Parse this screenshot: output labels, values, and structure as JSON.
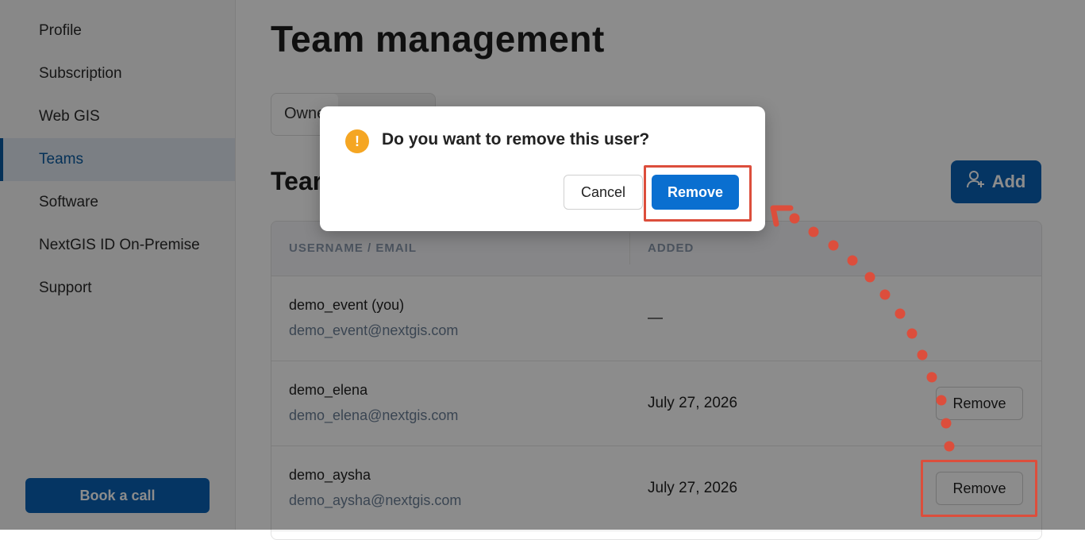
{
  "sidebar": {
    "items": [
      {
        "label": "Profile"
      },
      {
        "label": "Subscription"
      },
      {
        "label": "Web GIS"
      },
      {
        "label": "Teams"
      },
      {
        "label": "Software"
      },
      {
        "label": "NextGIS ID On-Premise"
      },
      {
        "label": "Support"
      }
    ],
    "active_item": "Teams",
    "book_call_label": "Book a call"
  },
  "main": {
    "title": "Team management",
    "tabs": [
      {
        "label": "Owne"
      }
    ],
    "section_title": "Tear",
    "add_label": "Add",
    "table": {
      "headers": [
        "USERNAME / EMAIL",
        "ADDED"
      ],
      "rows": [
        {
          "name": "demo_event (you)",
          "email": "demo_event@nextgis.com",
          "added": "—",
          "action": ""
        },
        {
          "name": "demo_elena",
          "email": "demo_elena@nextgis.com",
          "added": "July 27, 2026",
          "action": "Remove"
        },
        {
          "name": "demo_aysha",
          "email": "demo_aysha@nextgis.com",
          "added": "July 27, 2026",
          "action": "Remove"
        }
      ]
    }
  },
  "dialog": {
    "message": "Do you want to remove this user?",
    "icon": "warning-icon",
    "icon_glyph": "!",
    "cancel_label": "Cancel",
    "confirm_label": "Remove"
  },
  "colors": {
    "brand": "#0a62b5",
    "active_nav_bg": "#e0e8f0",
    "warning": "#f5a623",
    "annotation": "#dc4e3c"
  }
}
